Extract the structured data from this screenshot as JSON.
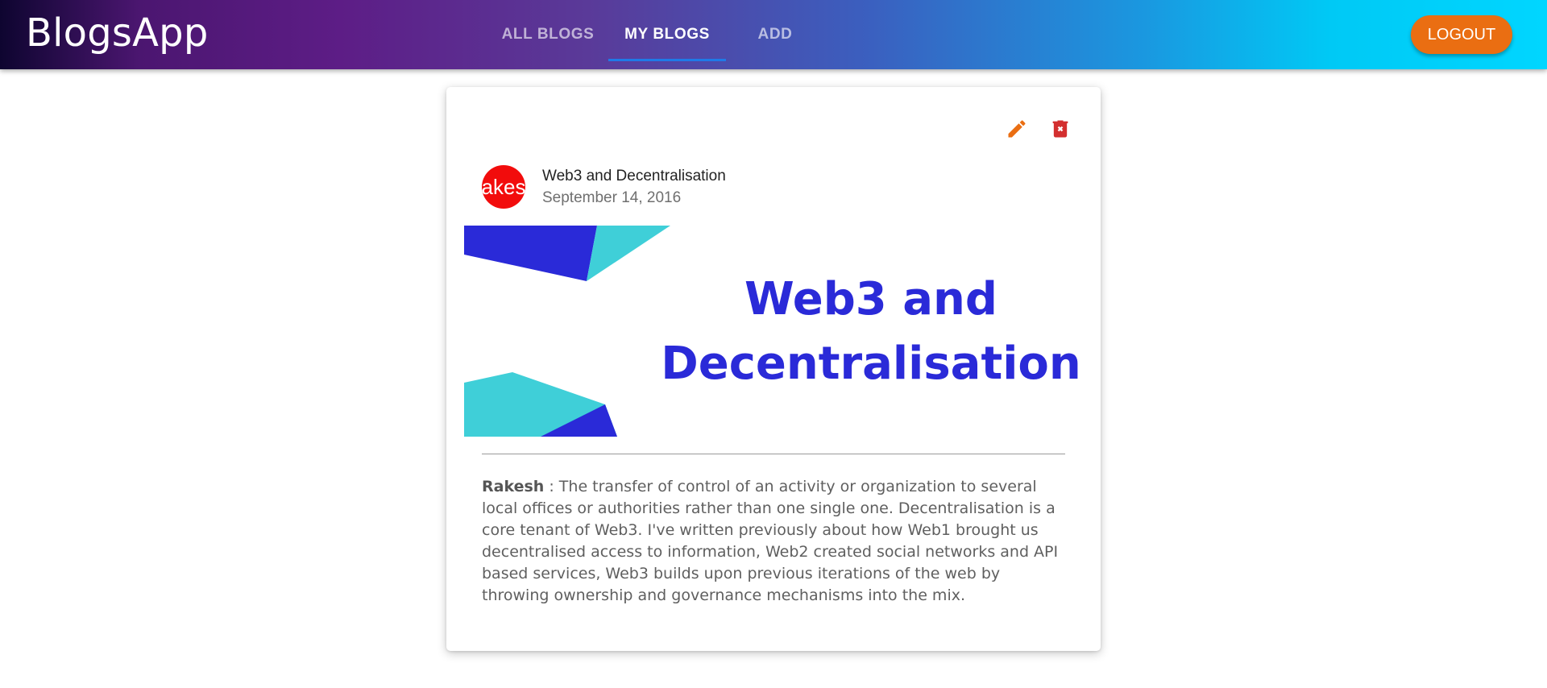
{
  "app": {
    "title": "BlogsApp"
  },
  "nav": {
    "tabs": [
      {
        "label": "ALL BLOGS",
        "active": false
      },
      {
        "label": "MY BLOGS",
        "active": true
      },
      {
        "label": "ADD",
        "active": false
      }
    ],
    "logout_label": "LOGOUT"
  },
  "colors": {
    "accent_orange": "#ea6e12",
    "delete_red": "#d32f2f",
    "avatar_red": "#f20c0c",
    "banner_blue": "#2a2ad8",
    "banner_cyan": "#3fcfd8",
    "tab_indicator": "#1f7ae8"
  },
  "post": {
    "avatar_text": "akes",
    "title": "Web3 and Decentralisation",
    "date": "September 14, 2016",
    "banner_line1": "Web3 and",
    "banner_line2": "Decentralisation",
    "author": "Rakesh",
    "separator": " : ",
    "description": "The transfer of control of an activity or organization to several local offices or authorities rather than one single one. Decentralisation is a core tenant of Web3. I've written previously about how Web1 brought us decentralised access to information, Web2 created social networks and API based services, Web3 builds upon previous iterations of the web by throwing ownership and governance mechanisms into the mix.",
    "actions": {
      "edit_icon": "pencil-icon",
      "delete_icon": "trash-x-icon"
    }
  }
}
